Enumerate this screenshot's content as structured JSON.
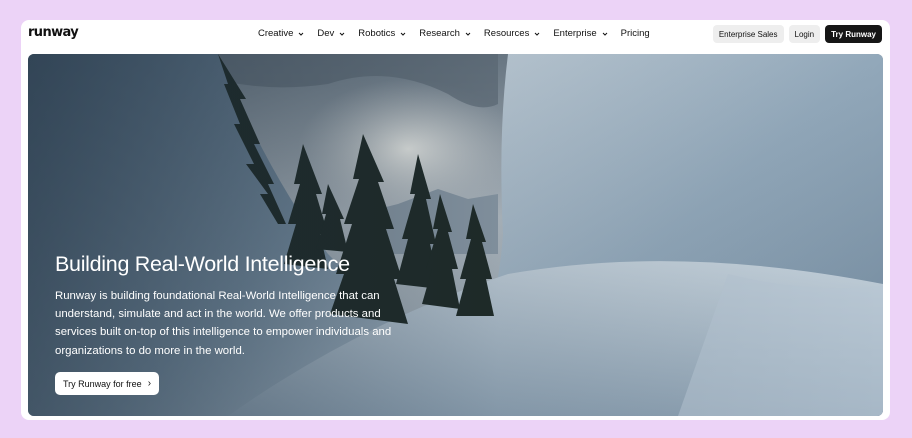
{
  "brand": {
    "logo": "runway"
  },
  "nav": {
    "items": [
      {
        "label": "Creative",
        "has_dropdown": true
      },
      {
        "label": "Dev",
        "has_dropdown": true
      },
      {
        "label": "Robotics",
        "has_dropdown": true
      },
      {
        "label": "Research",
        "has_dropdown": true
      },
      {
        "label": "Resources",
        "has_dropdown": true
      },
      {
        "label": "Enterprise",
        "has_dropdown": true
      },
      {
        "label": "Pricing",
        "has_dropdown": false
      }
    ],
    "enterprise_sales": "Enterprise Sales",
    "login": "Login",
    "try": "Try Runway"
  },
  "hero": {
    "title": "Building Real-World Intelligence",
    "description": "Runway is building foundational Real-World Intelligence that can understand, simulate and act in the world. We offer products and services built on-top of this intelligence to empower individuals and organizations to do more in the world.",
    "cta": "Try Runway for free",
    "cta_icon": "chevron-right-icon"
  },
  "colors": {
    "page_background": "#ecd3f7",
    "dark_button": "#161616",
    "light_button": "#eeeeee"
  }
}
